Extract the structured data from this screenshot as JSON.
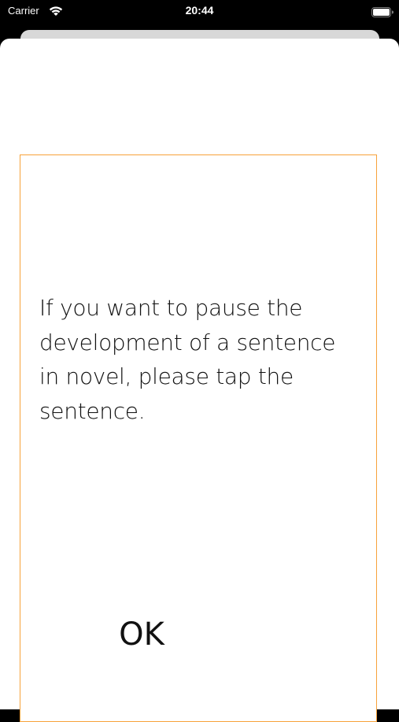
{
  "status_bar": {
    "carrier": "Carrier",
    "time": "20:44",
    "wifi_icon": "wifi-icon",
    "battery_icon": "battery-icon"
  },
  "dialog": {
    "message": "If you want to pause the development of a sentence in novel, please tap the sentence.",
    "ok_label": "OK",
    "border_color": "#f7a23a"
  }
}
